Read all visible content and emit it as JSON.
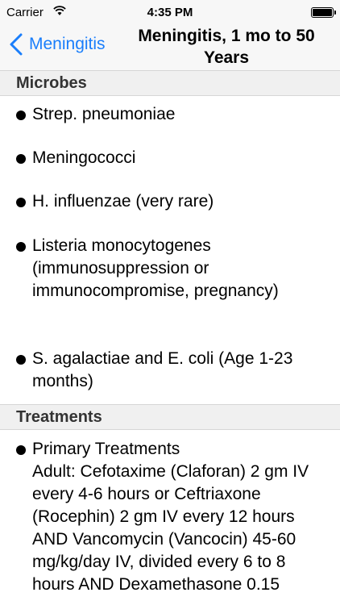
{
  "status_bar": {
    "carrier": "Carrier",
    "time": "4:35 PM"
  },
  "nav": {
    "back_label": "Meningitis",
    "title": "Meningitis, 1 mo to 50 Years"
  },
  "sections": [
    {
      "header": "Microbes",
      "items": [
        "Strep. pneumoniae",
        "Meningococci",
        "H. influenzae (very rare)",
        "Listeria monocytogenes (immunosuppression or immunocompromise, pregnancy)",
        "S. agalactiae and E. coli (Age 1-23 months)"
      ]
    },
    {
      "header": "Treatments",
      "items": [
        "Primary Treatments\nAdult: Cefotaxime (Claforan) 2 gm IV every 4-6 hours or Ceftriaxone (Rocephin) 2 gm IV every 12 hours AND Vancomycin (Vancocin) 45-60 mg/kg/day IV, divided every 6 to 8 hours AND Dexamethasone 0.15"
      ]
    }
  ]
}
